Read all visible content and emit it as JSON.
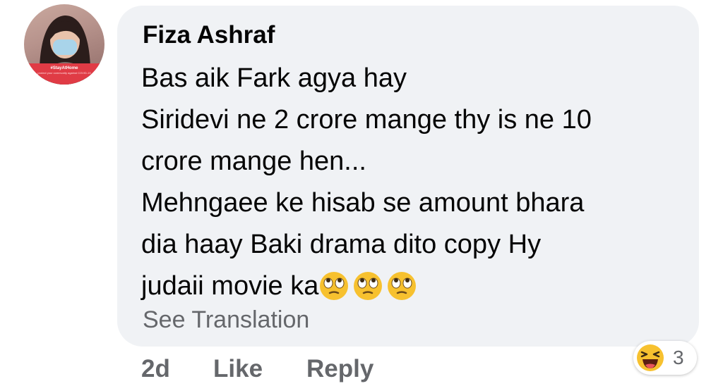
{
  "comment": {
    "author": "Fiza Ashraf",
    "avatar_badge_line1": "#StayAtHome",
    "avatar_badge_line2": "protect your community against COVID-19",
    "lines": [
      "Bas aik Fark agya hay",
      "Siridevi ne 2 crore mange thy is ne 10",
      "crore mange hen...",
      "Mehngaee ke hisab se amount bhara",
      "dia haay Baki drama dito copy Hy",
      "judaii movie ka"
    ],
    "trailing_emojis": [
      "face-with-rolling-eyes",
      "face-with-rolling-eyes",
      "face-with-rolling-eyes"
    ],
    "see_translation": "See Translation"
  },
  "actions": {
    "time": "2d",
    "like": "Like",
    "reply": "Reply"
  },
  "reactions": {
    "icon": "laughing-face",
    "count": "3"
  },
  "colors": {
    "bubble": "#f0f2f5",
    "text": "#050505",
    "secondary": "#65676b",
    "emoji": "#f7c12f"
  }
}
